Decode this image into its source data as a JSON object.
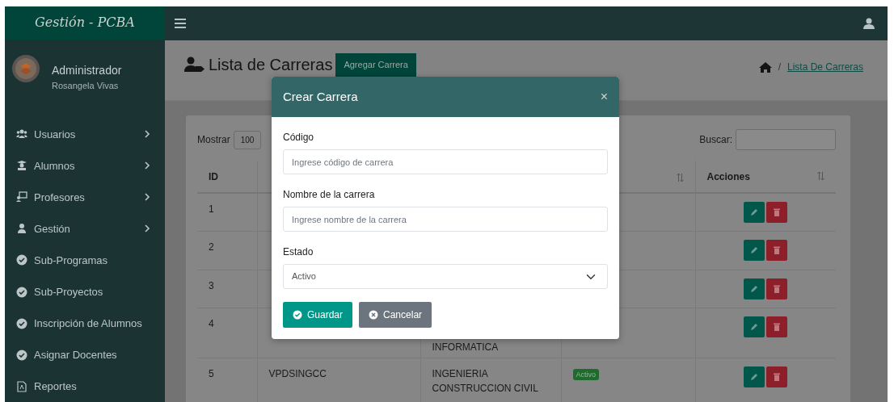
{
  "brand": "Gestión - PCBA",
  "user": {
    "role": "Administrador",
    "name": "Rosangela Vivas"
  },
  "sidebar": {
    "items": [
      {
        "label": "Usuarios",
        "kind": "users",
        "has_submenu": true
      },
      {
        "label": "Alumnos",
        "kind": "student",
        "has_submenu": true
      },
      {
        "label": "Profesores",
        "kind": "teacher",
        "has_submenu": true
      },
      {
        "label": "Gestión",
        "kind": "manager",
        "has_submenu": true
      },
      {
        "label": "Sub-Programas",
        "kind": "check",
        "has_submenu": false
      },
      {
        "label": "Sub-Proyectos",
        "kind": "check",
        "has_submenu": false
      },
      {
        "label": "Inscripción de Alumnos",
        "kind": "check",
        "has_submenu": false
      },
      {
        "label": "Asignar Docentes",
        "kind": "check",
        "has_submenu": false
      },
      {
        "label": "Reportes",
        "kind": "pdf",
        "has_submenu": false
      }
    ]
  },
  "page": {
    "title": "Lista de Carreras",
    "add_button": "Agregar Carrera",
    "breadcrumb_separator": "/",
    "breadcrumb": [
      "Lista De Carreras"
    ]
  },
  "table_controls": {
    "show_label": "Mostrar",
    "page_size": "100",
    "search_label": "Buscar:"
  },
  "table": {
    "columns": [
      {
        "label": "ID",
        "sortable": false
      },
      {},
      {},
      {
        "sortable": true
      },
      {
        "label": "Acciones",
        "sortable": true
      }
    ],
    "rows": [
      {
        "id": "1"
      },
      {
        "id": "2"
      },
      {
        "id": "3"
      },
      {
        "id": "4",
        "name": "INFORMATICA"
      },
      {
        "id": "5",
        "code": "VPDSINGCC",
        "name": "INGENIERIA CONSTRUCCION CIVIL",
        "status": "Activo"
      }
    ]
  },
  "modal": {
    "title": "Crear Carrera",
    "close": "×",
    "fields": [
      {
        "kind": "text",
        "label": "Código",
        "placeholder": "Ingrese código de carrera"
      },
      {
        "kind": "text",
        "label": "Nombre de la carrera",
        "placeholder": "Ingrese nombre de la carrera"
      },
      {
        "kind": "select",
        "label": "Estado",
        "value": "Activo"
      }
    ],
    "buttons": [
      {
        "kind": "primary",
        "label": "Guardar"
      },
      {
        "kind": "secondary",
        "label": "Cancelar"
      }
    ]
  }
}
